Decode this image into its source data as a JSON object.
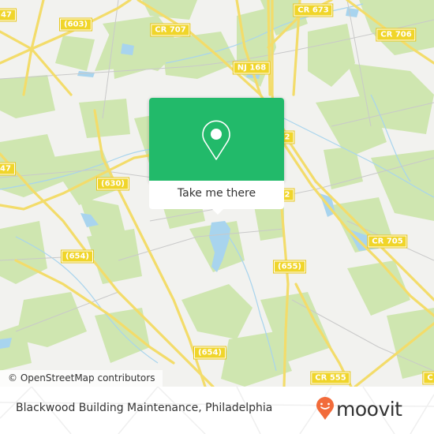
{
  "map": {
    "attribution": "© OpenStreetMap contributors",
    "colors": {
      "land": "#f2f2ef",
      "forest": "#cfe6b0",
      "water": "#a8d4ee",
      "road": "#f3dc6a",
      "minor_road": "#c9c9c9",
      "label_bg": "#f0d52a"
    },
    "road_labels": [
      {
        "id": "603",
        "text": "(603)"
      },
      {
        "id": "cr707",
        "text": "CR 707"
      },
      {
        "id": "cr673",
        "text": "CR 673"
      },
      {
        "id": "cr706",
        "text": "CR 706"
      },
      {
        "id": "nj168",
        "text": "NJ 168"
      },
      {
        "id": "47a",
        "text": "47"
      },
      {
        "id": "47b",
        "text": "47"
      },
      {
        "id": "630",
        "text": "(630)"
      },
      {
        "id": "654a",
        "text": "(654)"
      },
      {
        "id": "655",
        "text": "(655)"
      },
      {
        "id": "cr705",
        "text": "CR 705"
      },
      {
        "id": "654b",
        "text": "(654)"
      },
      {
        "id": "cr555",
        "text": "CR 555"
      },
      {
        "id": "c",
        "text": "C"
      },
      {
        "id": "nj42a",
        "text": "2"
      },
      {
        "id": "nj42b",
        "text": "2"
      }
    ]
  },
  "popup": {
    "icon": "map-pin-icon",
    "button_label": "Take me there",
    "accent_color": "#22ba6a"
  },
  "footer": {
    "place_title": "Blackwood Building Maintenance, Philadelphia",
    "brand": "moovit",
    "brand_color": "#f26b3a"
  }
}
